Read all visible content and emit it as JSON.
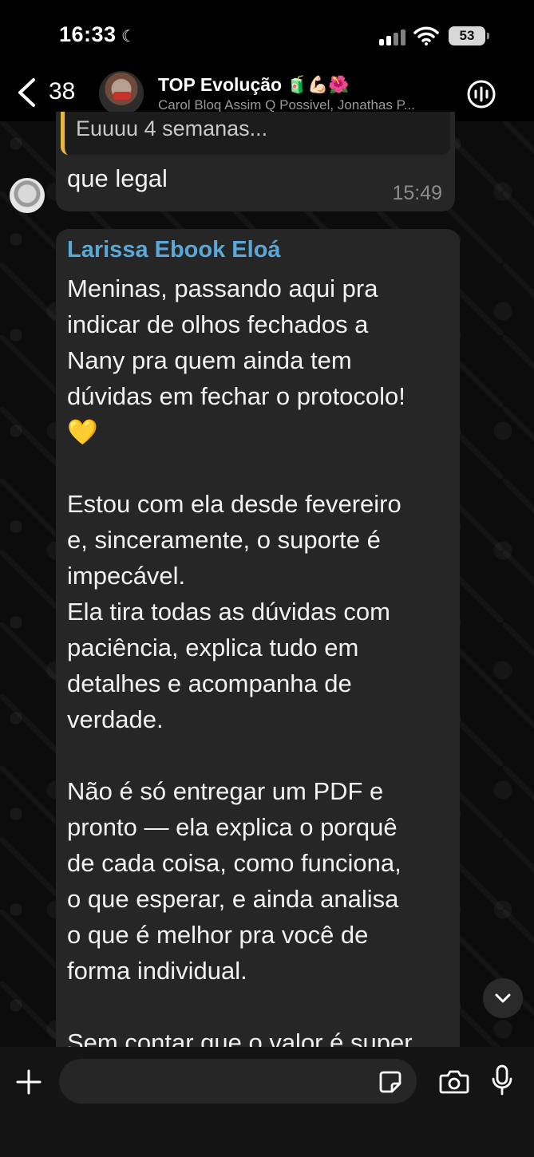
{
  "status_bar": {
    "time": "16:33",
    "battery": "53",
    "icons": [
      "moon-icon",
      "signal-icon",
      "wifi-icon",
      "battery-icon"
    ]
  },
  "header": {
    "unread_count": "38",
    "group_name": "TOP Evolução",
    "group_emojis": "🧃💪🏻🌺",
    "members": "Carol Bloq Assim Q Possivel, Jonathas P...",
    "icons": [
      "back-icon",
      "call-icon"
    ]
  },
  "messages": [
    {
      "quote": "Euuuu 4 semanas...",
      "text": "que legal",
      "time": "15:49"
    },
    {
      "sender": "Larissa Ebook Eloá",
      "lines": [
        "Meninas, passando aqui pra",
        "indicar de olhos fechados a",
        "Nany pra quem ainda tem",
        "dúvidas em fechar o protocolo!",
        "💛",
        "",
        "Estou com ela desde fevereiro",
        "e, sinceramente, o suporte é",
        "impecável.",
        "Ela tira todas as dúvidas com",
        "paciência, explica tudo em",
        "detalhes e acompanha de",
        "verdade.",
        "",
        "Não é só entregar um PDF e",
        "pronto — ela explica o porquê",
        "de cada coisa, como funciona,",
        "o que esperar, e ainda analisa",
        "o que é melhor pra você de",
        "forma individual.",
        "",
        "Sem contar que o valor é super"
      ]
    }
  ],
  "composer": {
    "placeholder": "",
    "icons": [
      "plus-icon",
      "sticker-icon",
      "camera-icon",
      "mic-icon"
    ]
  },
  "colors": {
    "sender_name": "#5aa8d8",
    "quote_bar": "#e5b842",
    "bubble": "#262626"
  }
}
